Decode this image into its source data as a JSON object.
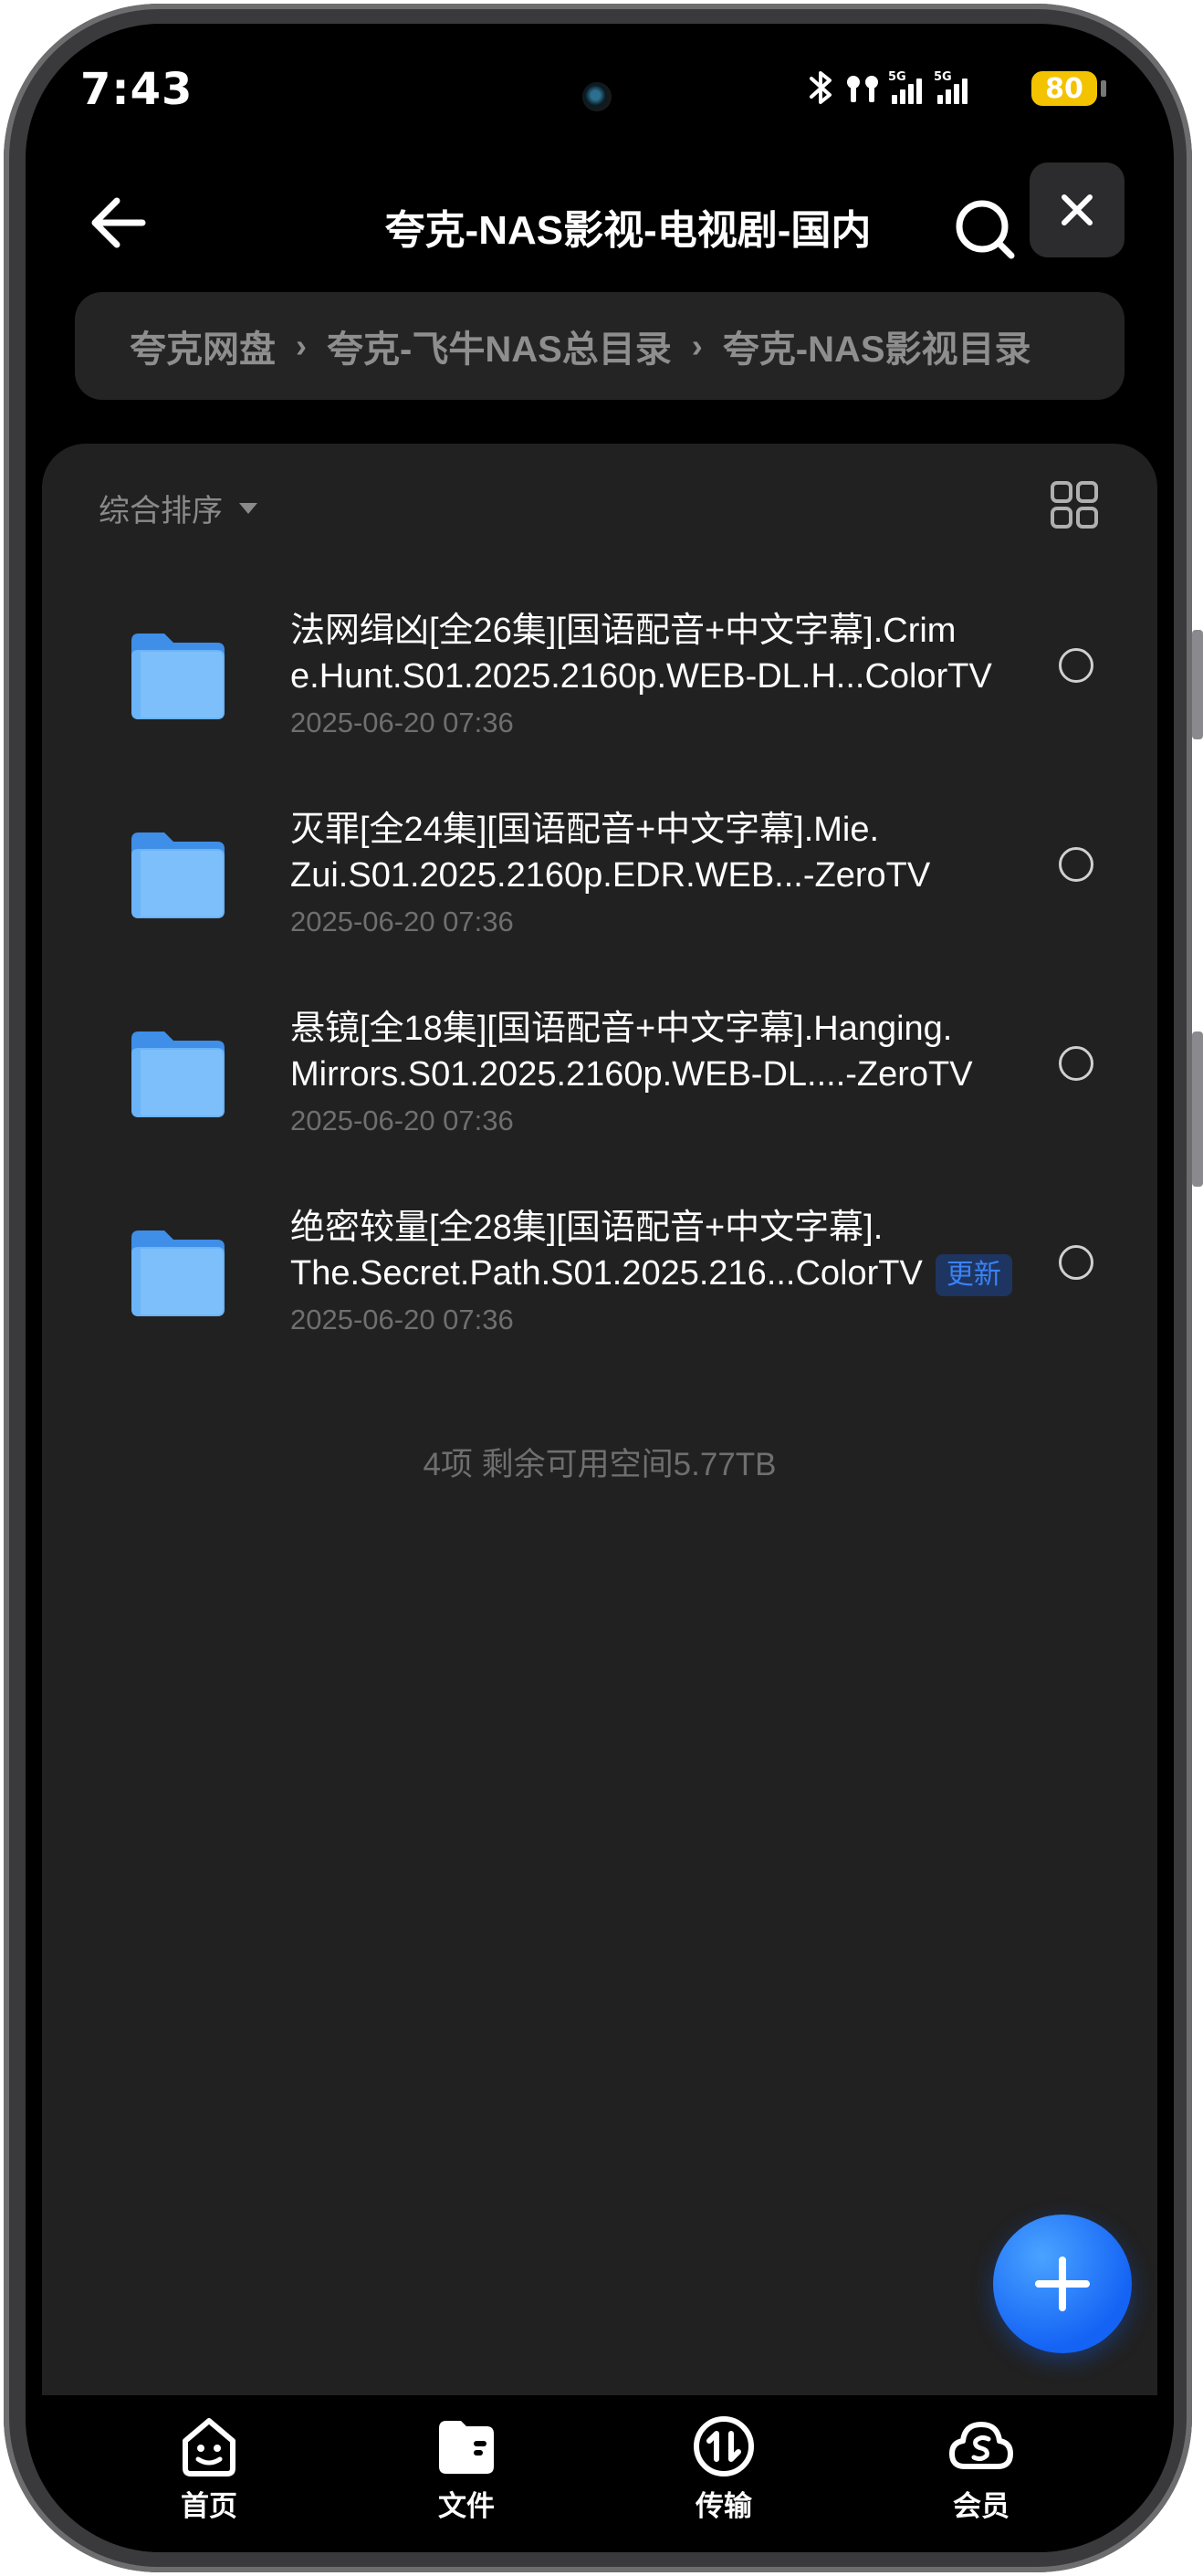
{
  "status_bar": {
    "time": "7:43",
    "battery": "80",
    "icons": [
      "bluetooth-icon",
      "hotspot-icon",
      "signal-5g-1-icon",
      "signal-5g-2-icon"
    ]
  },
  "header": {
    "title": "夸克-NAS影视-电视剧-国内",
    "back_icon": "arrow-left-icon",
    "search_icon": "search-icon",
    "close_icon": "close-icon"
  },
  "breadcrumb": {
    "items": [
      "夸克网盘",
      "夸克-飞牛NAS总目录",
      "夸克-NAS影视目录"
    ],
    "separator": "›"
  },
  "toolbar": {
    "sort_label": "综合排序",
    "view_icon": "grid-view-icon"
  },
  "files": [
    {
      "name_line1": "法网缉凶[全26集][国语配音+中文字幕].Crim",
      "name_line2": "e.Hunt.S01.2025.2160p.WEB-DL.H...ColorTV",
      "date": "2025-06-20 07:36",
      "badge": ""
    },
    {
      "name_line1": "灭罪[全24集][国语配音+中文字幕].Mie.",
      "name_line2": "Zui.S01.2025.2160p.EDR.WEB...-ZeroTV",
      "date": "2025-06-20 07:36",
      "badge": ""
    },
    {
      "name_line1": "悬镜[全18集][国语配音+中文字幕].Hanging.",
      "name_line2": "Mirrors.S01.2025.2160p.WEB-DL....-ZeroTV",
      "date": "2025-06-20 07:36",
      "badge": ""
    },
    {
      "name_line1": "绝密较量[全28集][国语配音+中文字幕].",
      "name_line2": "The.Secret.Path.S01.2025.216...ColorTV",
      "date": "2025-06-20 07:36",
      "badge": "更新"
    }
  ],
  "summary": "4项 剩余可用空间5.77TB",
  "fab_icon": "plus-icon",
  "bottom_nav": [
    {
      "label": "首页",
      "icon": "home-smile-icon"
    },
    {
      "label": "文件",
      "icon": "folder-icon"
    },
    {
      "label": "传输",
      "icon": "transfer-icon"
    },
    {
      "label": "会员",
      "icon": "member-cloud-icon"
    }
  ],
  "colors": {
    "background": "#000000",
    "panel": "#212121",
    "accent": "#1463f5",
    "battery": "#f4c300",
    "muted_text": "#6f6f6f"
  }
}
